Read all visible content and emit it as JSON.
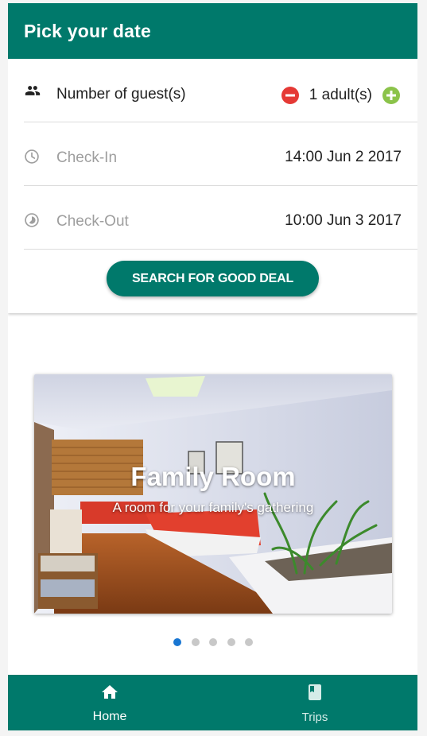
{
  "header": {
    "title": "Pick your date"
  },
  "form": {
    "guests": {
      "label": "Number of guest(s)",
      "value": "1 adult(s)",
      "minus_icon": "remove-circle-icon",
      "plus_icon": "add-circle-icon"
    },
    "checkin": {
      "label": "Check-In",
      "value": "14:00 Jun 2 2017",
      "icon": "clock-icon"
    },
    "checkout": {
      "label": "Check-Out",
      "value": "10:00 Jun 3 2017",
      "icon": "timelapse-icon"
    },
    "search_label": "SEARCH FOR GOOD DEAL"
  },
  "carousel": {
    "slides": [
      {
        "title": "Family Room",
        "subtitle": "A room for your family's gathering"
      }
    ],
    "active_index": 0,
    "dot_count": 5
  },
  "bottom_nav": {
    "items": [
      {
        "label": "Home",
        "icon": "home-icon",
        "active": true
      },
      {
        "label": "Trips",
        "icon": "book-icon",
        "active": false
      }
    ]
  },
  "colors": {
    "primary": "#00796b",
    "minus": "#e53935",
    "plus": "#8bc34a",
    "active_dot": "#1976d2"
  }
}
